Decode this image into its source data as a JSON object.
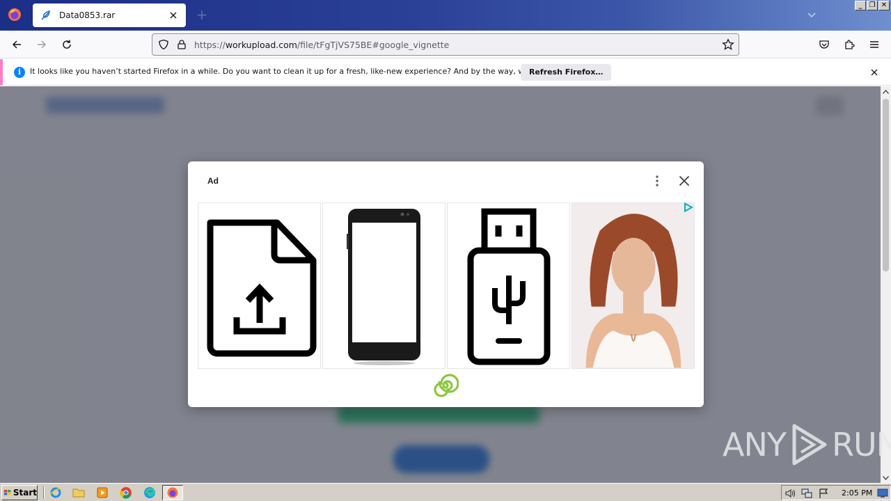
{
  "browser": {
    "tab": {
      "title": "Data0853.rar",
      "icon": "feather-icon"
    },
    "url": {
      "prefix": "https://",
      "host": "workupload.com",
      "path": "/file/tFgTjVS75BE#google_vignette"
    },
    "window_buttons": [
      "_",
      "❐",
      "✕"
    ]
  },
  "notification": {
    "message": "It looks like you haven’t started Firefox in a while. Do you want to clean it up for a fresh, like-new experience? And by the way, welcome back!",
    "button_label": "Refresh Firefox…"
  },
  "ad": {
    "label": "Ad",
    "tiles": [
      {
        "name": "file-upload-icon"
      },
      {
        "name": "smartphone-image"
      },
      {
        "name": "usb-drive-icon"
      },
      {
        "name": "woman-photo"
      }
    ]
  },
  "watermark": {
    "text_left": "ANY",
    "text_right": "RUN"
  },
  "taskbar": {
    "start_label": "Start",
    "clock": "2:05 PM",
    "quick_launch": [
      "ie-icon",
      "folder-icon",
      "media-player-icon",
      "chrome-icon",
      "edge-icon",
      "firefox-icon"
    ]
  },
  "colors": {
    "tab_strip": "#1c2f87",
    "notification_accent": "#ff7ec7",
    "info_icon": "#0a84ff",
    "ad_brand_green": "#8dc63f"
  }
}
